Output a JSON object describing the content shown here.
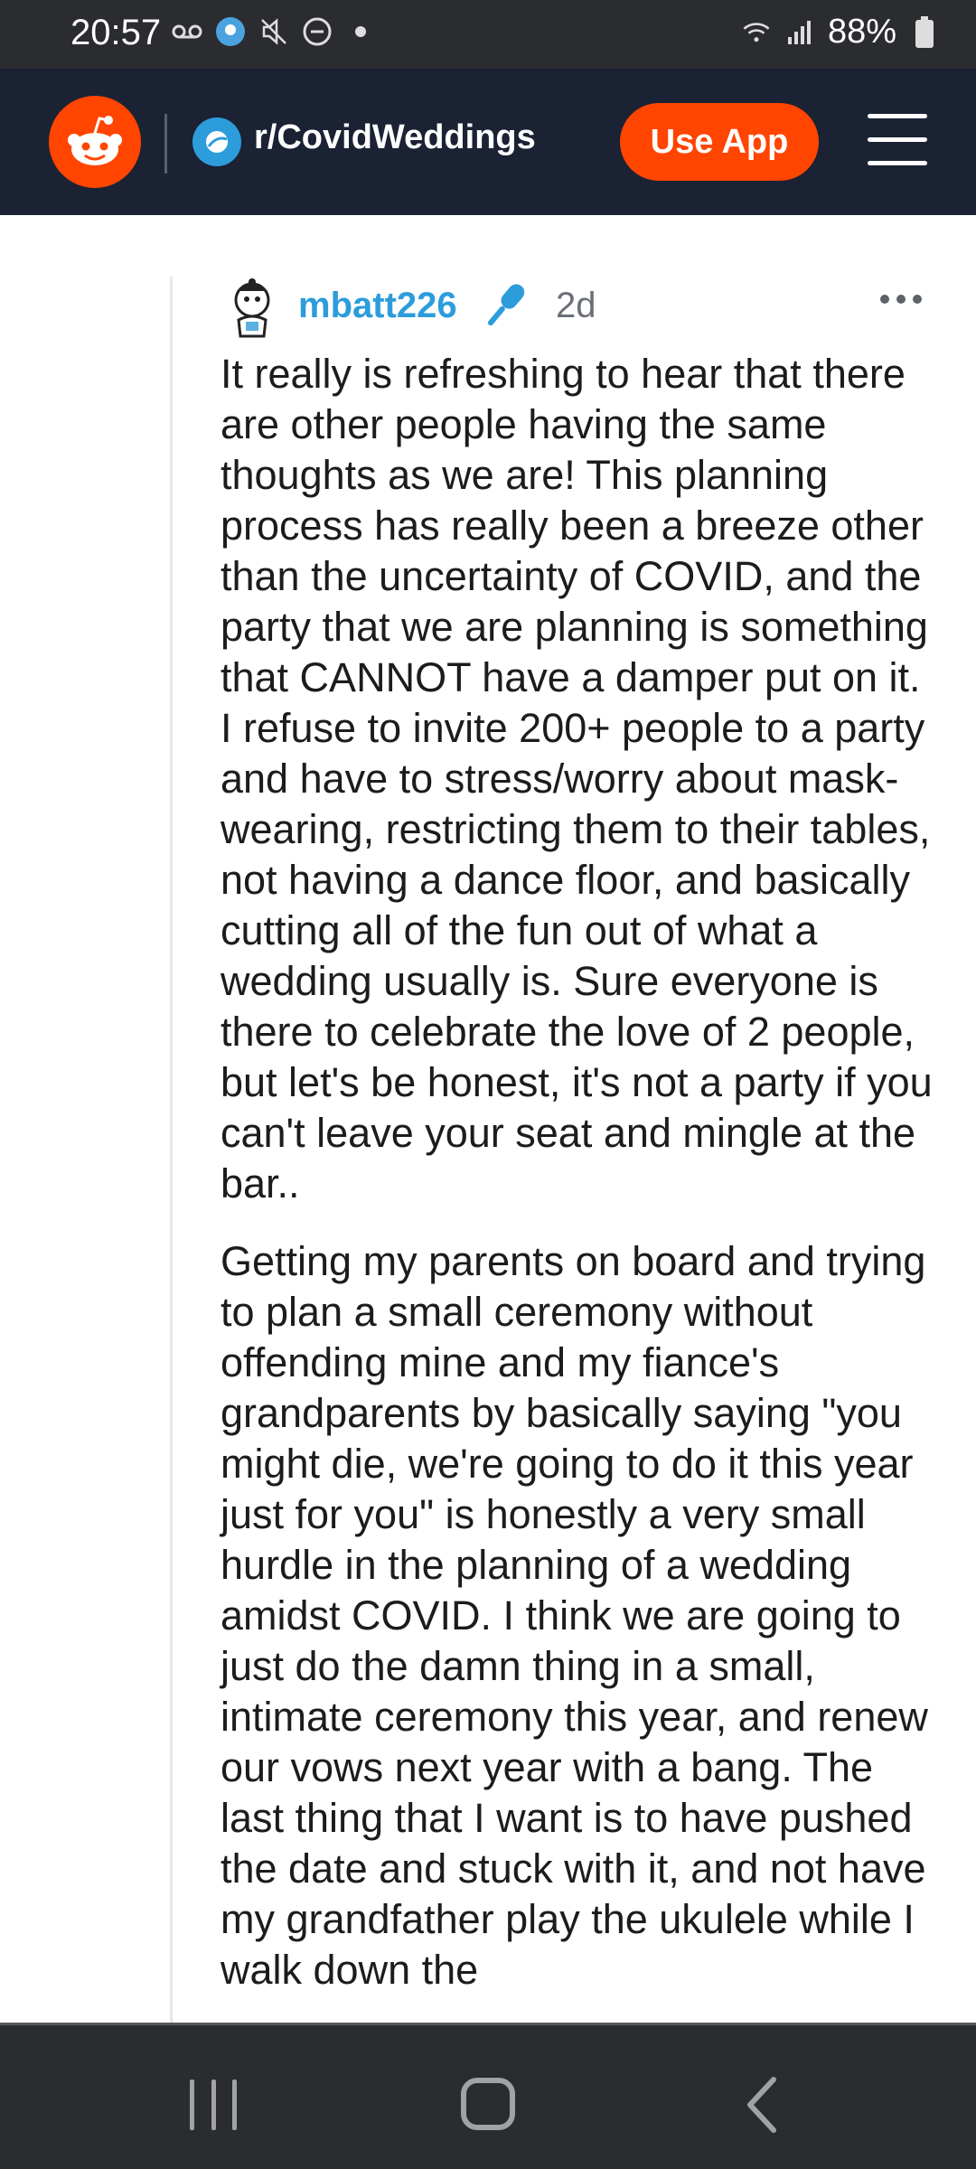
{
  "status_bar": {
    "time": "20:57",
    "battery": "88%"
  },
  "header": {
    "subreddit": "r/CovidWeddings",
    "use_app_label": "Use App"
  },
  "comment": {
    "username": "mbatt226",
    "age": "2d",
    "paragraphs": [
      "It really is refreshing to hear that there are other people having the same thoughts as we are! This planning process has really been a breeze other than the uncertainty of COVID, and the party that we are planning is something that CANNOT have a damper put on it. I refuse to invite 200+ people to a party and have to stress/worry about mask-wearing, restricting them to their tables, not having a dance floor, and basically cutting all of the fun out of what a wedding usually is. Sure everyone is there to celebrate the love of 2 people, but let's be honest, it's not a party if you can't leave your seat and mingle at the bar..",
      "Getting my parents on board and trying to plan a small ceremony without offending mine and my fiance's grandparents by basically saying \"you might die, we're going to do it this year just for you\" is honestly a very small hurdle in the planning of a wedding amidst COVID. I think we are going to just do the damn thing in a small, intimate ceremony this year, and renew our vows next year with a bang. The last thing that I want is to have pushed the date and stuck with it, and not have my grandfather play the ukulele while I walk down the"
    ]
  },
  "colors": {
    "brand_orange": "#ff4500",
    "header_bg": "#1a2233",
    "username_blue": "#2d9cdb"
  },
  "icons": {
    "reddit_logo": "reddit-snoo-icon",
    "subreddit": "subreddit-icon",
    "flair": "microphone-icon",
    "menu": "hamburger-menu-icon",
    "more": "more-horizontal-icon"
  }
}
